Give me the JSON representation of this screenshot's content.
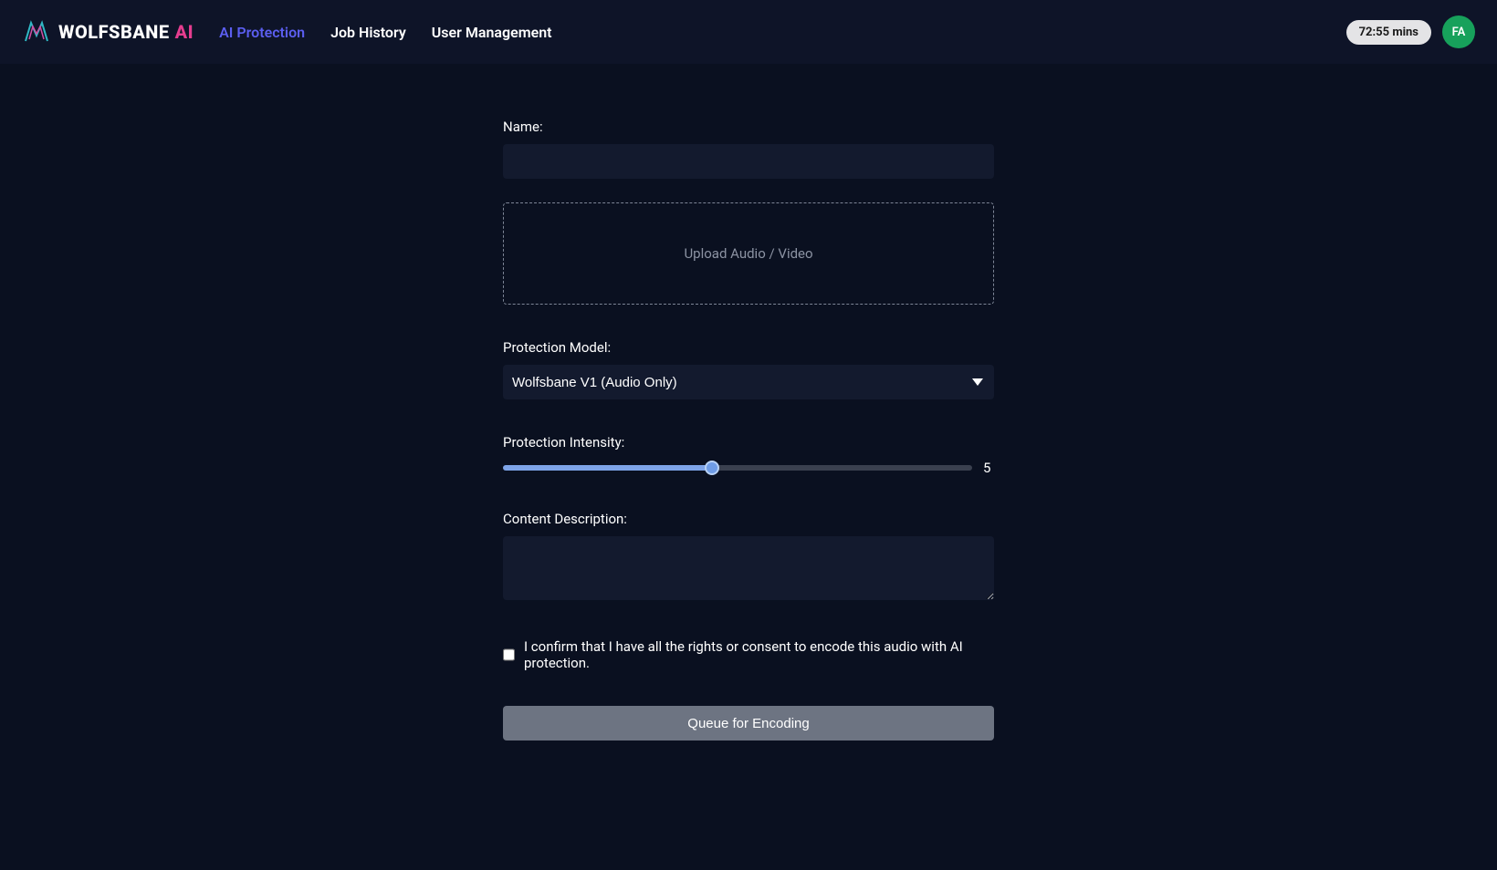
{
  "header": {
    "logo": {
      "wolfsbane": "WOLFSBANE",
      "ai": "AI"
    },
    "nav": {
      "ai_protection": "AI Protection",
      "job_history": "Job History",
      "user_management": "User Management"
    },
    "time_badge": "72:55 mins",
    "avatar_initials": "FA"
  },
  "form": {
    "name_label": "Name:",
    "name_value": "",
    "upload_label": "Upload Audio / Video",
    "model_label": "Protection Model:",
    "model_selected": "Wolfsbane V1 (Audio Only)",
    "intensity_label": "Protection Intensity:",
    "intensity_value": "5",
    "description_label": "Content Description:",
    "description_value": "",
    "consent_label": "I confirm that I have all the rights or consent to encode this audio with AI protection.",
    "submit_label": "Queue for Encoding"
  }
}
